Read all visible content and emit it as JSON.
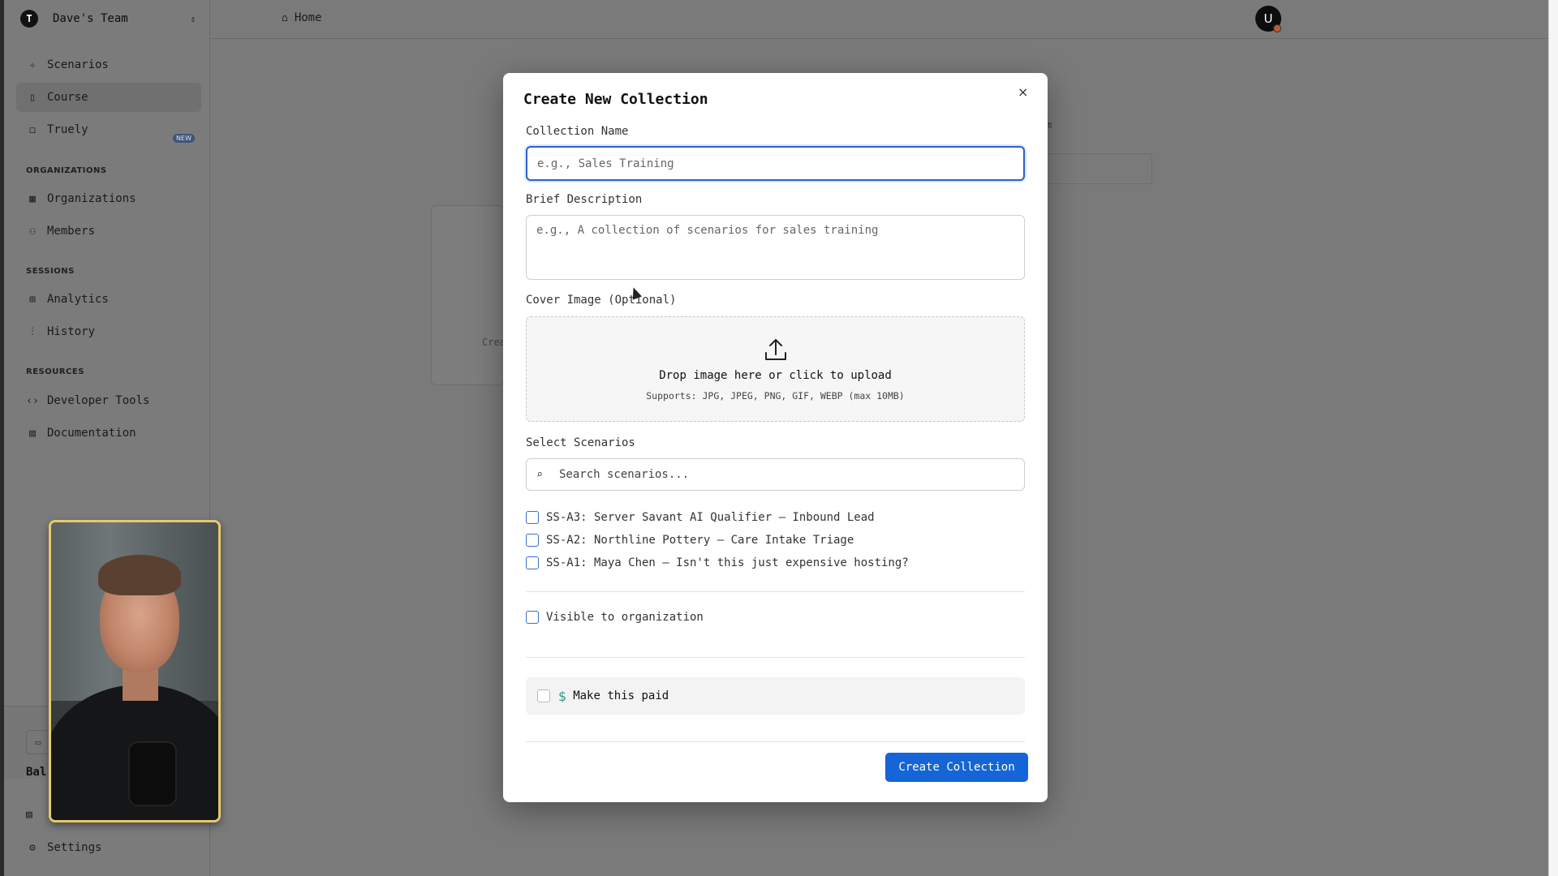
{
  "sidebar": {
    "team_logo": "T",
    "team_name": "Dave's Team",
    "nav_main": [
      {
        "label": "Scenarios",
        "icon": "sparkle-icon"
      },
      {
        "label": "Course",
        "icon": "book-icon"
      },
      {
        "label": "Truely",
        "icon": "chat-icon",
        "badge": "NEW"
      }
    ],
    "section_organizations": "ORGANIZATIONS",
    "nav_organizations": [
      {
        "label": "Organizations",
        "icon": "building-icon"
      },
      {
        "label": "Members",
        "icon": "users-icon"
      }
    ],
    "section_sessions": "SESSIONS",
    "nav_sessions": [
      {
        "label": "Analytics",
        "icon": "grid-icon"
      },
      {
        "label": "History",
        "icon": "bar-chart-icon"
      }
    ],
    "section_resources": "RESOURCES",
    "nav_resources": [
      {
        "label": "Developer Tools",
        "icon": "code-icon"
      },
      {
        "label": "Documentation",
        "icon": "document-icon"
      }
    ],
    "bottom_partial": "Bal",
    "settings": "Settings"
  },
  "header": {
    "breadcrumb": "Home",
    "avatar_initial": "U"
  },
  "background": {
    "card_text": "Crea",
    "field_label_partial": "m"
  },
  "modal": {
    "title": "Create New Collection",
    "close": "×",
    "name_label": "Collection Name",
    "name_placeholder": "e.g., Sales Training",
    "name_value": "",
    "desc_label": "Brief Description",
    "desc_placeholder": "e.g., A collection of scenarios for sales training",
    "desc_value": "",
    "cover_label": "Cover Image (Optional)",
    "upload_main": "Drop image here or click to upload",
    "upload_sub": "Supports: JPG, JPEG, PNG, GIF, WEBP (max 10MB)",
    "scenarios_label": "Select Scenarios",
    "search_placeholder": "Search scenarios...",
    "scenarios": [
      {
        "label": "SS-A3: Server Savant AI Qualifier — Inbound Lead",
        "checked": false
      },
      {
        "label": "SS-A2: Northline Pottery — Care Intake Triage",
        "checked": false
      },
      {
        "label": "SS-A1: Maya Chen — Isn't this just expensive hosting?",
        "checked": false
      }
    ],
    "visible_label": "Visible to organization",
    "paid_symbol": "$",
    "paid_label": "Make this paid",
    "submit": "Create Collection"
  },
  "colors": {
    "primary": "#1565d8",
    "focus_ring": "#2a62c9",
    "paid_accent": "#2a9d8f",
    "overlay": "#7a7a7a",
    "webcam_border": "#e7c96c"
  }
}
